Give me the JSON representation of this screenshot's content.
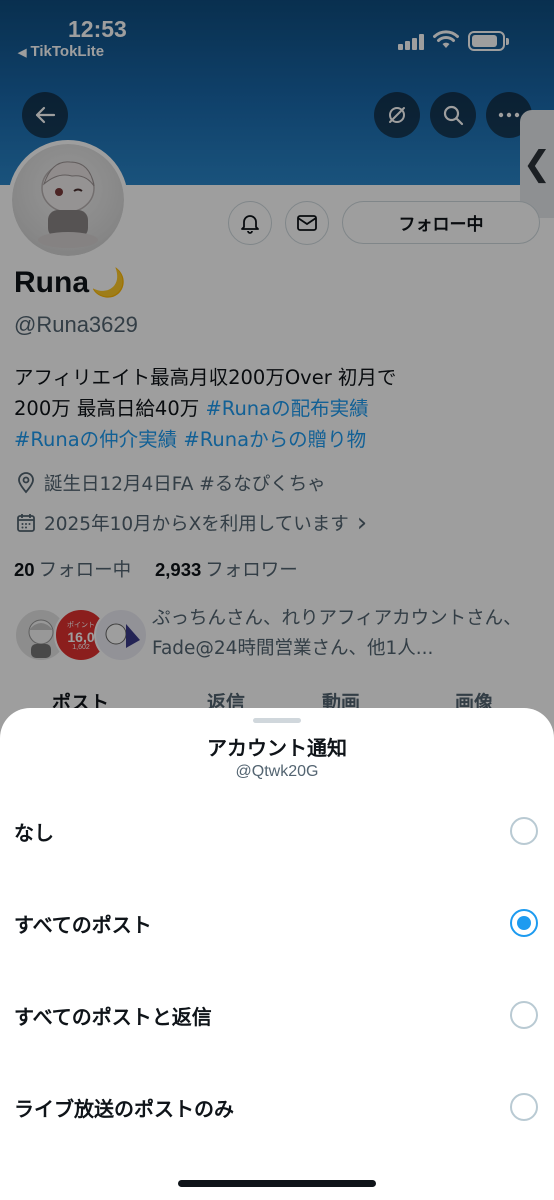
{
  "status_bar": {
    "time": "12:53",
    "back_app": "TikTokLite",
    "back_arrow_icon": "small-left-triangle-icon"
  },
  "header": {
    "back_icon": "arrow-left-icon",
    "mute_icon": "notifications-off-icon",
    "search_icon": "search-icon",
    "more_icon": "more-horizontal-icon",
    "side_tab_icon": "chevron-left-icon",
    "side_tab_glyph": "❮"
  },
  "profile": {
    "name": "Runa",
    "name_emoji": "🌙",
    "handle": "@Runa3629",
    "follow_button": "フォロー中",
    "bio_line1": "アフィリエイト最高月収200万Over 初月で",
    "bio_line2_text": "200万 最高日給40万 ",
    "bio_tag1": "#Runaの配布実績",
    "bio_tag2": "#Runaの仲介実績",
    "bio_tag3": "#Runaからの贈り物",
    "location": "誕生日12月4日FA #るなぴくちゃ",
    "joined": "2025年10月からXを利用しています",
    "joined_chevron": "›",
    "following_count": "20",
    "following_label": "フォロー中",
    "followers_count": "2,933",
    "followers_label": "フォロワー",
    "followed_by": "ぷっちんさん、れりアフィアカウントさん、Fade@24時間営業さん、他1人...",
    "fav_point_label": "ポイント",
    "fav_point_value": "16,0",
    "fav_point_sub": "1,602"
  },
  "tabs": [
    "ポスト",
    "返信",
    "動画",
    "画像"
  ],
  "sheet": {
    "title": "アカウント通知",
    "subtitle": "@Qtwk20G",
    "options": [
      {
        "label": "なし",
        "selected": false
      },
      {
        "label": "すべてのポスト",
        "selected": true
      },
      {
        "label": "すべてのポストと返信",
        "selected": false
      },
      {
        "label": "ライブ放送のポストのみ",
        "selected": false
      }
    ]
  },
  "colors": {
    "accent": "#1d9bf0",
    "banner": "#1a6aad",
    "text_primary": "#0f1419",
    "text_secondary": "#536471"
  }
}
